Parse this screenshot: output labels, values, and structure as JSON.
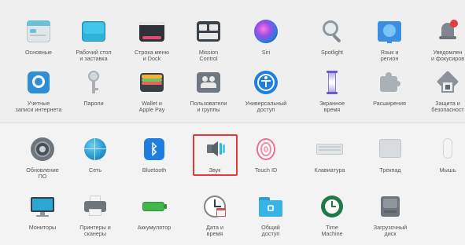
{
  "highlighted_item": "sound",
  "colors": {
    "highlight_border": "#e23b3b",
    "background": "#f2f2f2"
  },
  "top_section": {
    "row1": [
      {
        "id": "general",
        "label": "Основные",
        "icon": "general-icon"
      },
      {
        "id": "desktop-screensaver",
        "label": "Рабочий стол\nи заставка",
        "icon": "desktop-icon"
      },
      {
        "id": "dock-menu",
        "label": "Строка меню\nи Dock",
        "icon": "dock-icon"
      },
      {
        "id": "mission-control",
        "label": "Mission\nControl",
        "icon": "mission-control-icon"
      },
      {
        "id": "siri",
        "label": "Siri",
        "icon": "siri-icon"
      },
      {
        "id": "spotlight",
        "label": "Spotlight",
        "icon": "spotlight-icon"
      },
      {
        "id": "language-region",
        "label": "Язык и\nрегион",
        "icon": "language-icon"
      },
      {
        "id": "notifications",
        "label": "Уведомлен\nи фокусиров",
        "icon": "notifications-icon"
      }
    ],
    "row2": [
      {
        "id": "internet-accounts",
        "label": "Учетные\nзаписи интернета",
        "icon": "internet-accounts-icon"
      },
      {
        "id": "passwords",
        "label": "Пароли",
        "icon": "key-icon"
      },
      {
        "id": "wallet",
        "label": "Wallet и\nApple Pay",
        "icon": "wallet-icon"
      },
      {
        "id": "users-groups",
        "label": "Пользователи\nи группы",
        "icon": "users-icon"
      },
      {
        "id": "accessibility",
        "label": "Универсальный\nдоступ",
        "icon": "accessibility-icon"
      },
      {
        "id": "screen-time",
        "label": "Экранное\nвремя",
        "icon": "hourglass-icon"
      },
      {
        "id": "extensions",
        "label": "Расширения",
        "icon": "puzzle-icon"
      },
      {
        "id": "security",
        "label": "Защита и\nбезопасност",
        "icon": "house-icon"
      }
    ]
  },
  "bottom_section": {
    "row1": [
      {
        "id": "software-update",
        "label": "Обновление\nПО",
        "icon": "gear-icon"
      },
      {
        "id": "network",
        "label": "Сеть",
        "icon": "globe-icon"
      },
      {
        "id": "bluetooth",
        "label": "Bluetooth",
        "icon": "bluetooth-icon"
      },
      {
        "id": "sound",
        "label": "Звук",
        "icon": "speaker-icon"
      },
      {
        "id": "touch-id",
        "label": "Touch ID",
        "icon": "fingerprint-icon"
      },
      {
        "id": "keyboard",
        "label": "Клавиатура",
        "icon": "keyboard-icon"
      },
      {
        "id": "trackpad",
        "label": "Трекпад",
        "icon": "trackpad-icon"
      },
      {
        "id": "mouse",
        "label": "Мышь",
        "icon": "mouse-icon"
      }
    ],
    "row2": [
      {
        "id": "displays",
        "label": "Мониторы",
        "icon": "monitor-icon"
      },
      {
        "id": "printers",
        "label": "Принтеры и\nсканеры",
        "icon": "printer-icon"
      },
      {
        "id": "battery",
        "label": "Аккумулятор",
        "icon": "battery-icon"
      },
      {
        "id": "date-time",
        "label": "Дата и\nвремя",
        "icon": "clock-icon"
      },
      {
        "id": "sharing",
        "label": "Общий\nдоступ",
        "icon": "folder-icon"
      },
      {
        "id": "time-machine",
        "label": "Time\nMachine",
        "icon": "time-machine-icon"
      },
      {
        "id": "startup-disk",
        "label": "Загрузочный\nдиск",
        "icon": "disk-icon"
      }
    ]
  }
}
